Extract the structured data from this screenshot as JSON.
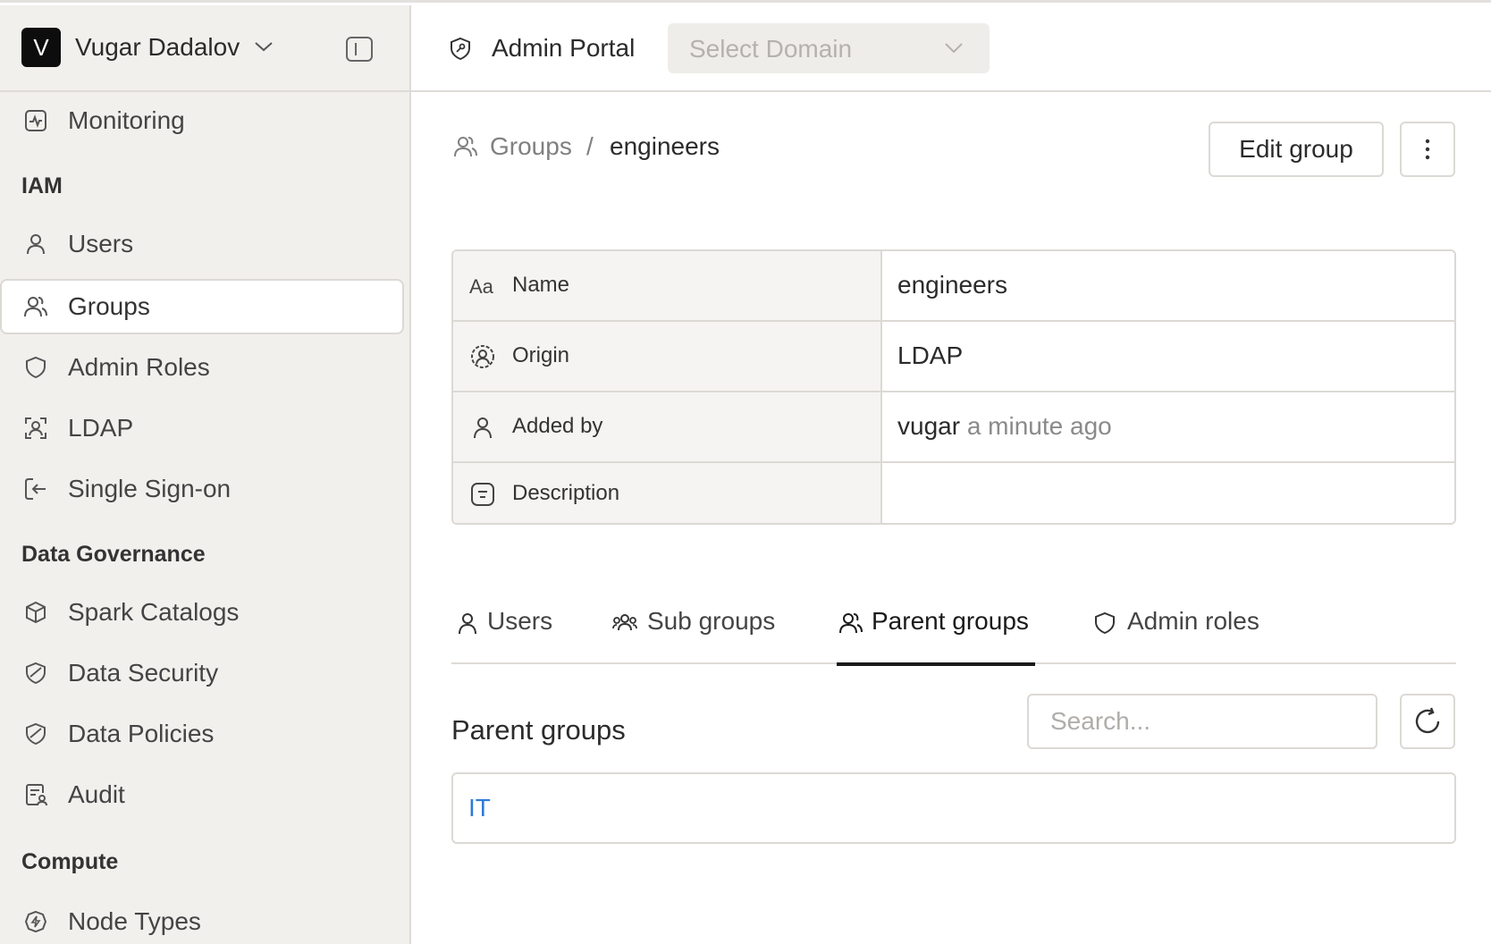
{
  "workspace": {
    "initial": "V",
    "name": "Vugar Dadalov"
  },
  "sidebar": {
    "top_items": [
      {
        "label": "Monitoring",
        "icon": "monitoring-icon"
      }
    ],
    "sections": [
      {
        "title": "IAM",
        "items": [
          {
            "label": "Users",
            "icon": "user-icon"
          },
          {
            "label": "Groups",
            "icon": "users-icon",
            "active": true
          },
          {
            "label": "Admin Roles",
            "icon": "shield-icon"
          },
          {
            "label": "LDAP",
            "icon": "ldap-icon"
          },
          {
            "label": "Single Sign-on",
            "icon": "sign-in-icon"
          }
        ]
      },
      {
        "title": "Data Governance",
        "items": [
          {
            "label": "Spark Catalogs",
            "icon": "cube-icon"
          },
          {
            "label": "Data Security",
            "icon": "shield-slash-icon"
          },
          {
            "label": "Data Policies",
            "icon": "shield-slash-icon"
          },
          {
            "label": "Audit",
            "icon": "audit-icon"
          }
        ]
      },
      {
        "title": "Compute",
        "items": [
          {
            "label": "Node Types",
            "icon": "chip-icon"
          }
        ]
      }
    ]
  },
  "topbar": {
    "title": "Admin Portal",
    "domain_placeholder": "Select Domain"
  },
  "breadcrumb": {
    "parent": "Groups",
    "separator": "/",
    "current": "engineers"
  },
  "actions": {
    "edit_label": "Edit group",
    "more_label": "⋮"
  },
  "properties": [
    {
      "key": "Name",
      "icon": "text-icon",
      "value": "engineers"
    },
    {
      "key": "Origin",
      "icon": "origin-icon",
      "value": "LDAP"
    },
    {
      "key": "Added by",
      "icon": "user-icon",
      "value": "vugar",
      "value_muted": "a minute ago"
    },
    {
      "key": "Description",
      "icon": "description-icon",
      "value": ""
    }
  ],
  "tabs": [
    {
      "label": "Users",
      "icon": "user-icon"
    },
    {
      "label": "Sub groups",
      "icon": "users-three-icon"
    },
    {
      "label": "Parent groups",
      "icon": "users-icon",
      "active": true
    },
    {
      "label": "Admin roles",
      "icon": "shield-icon"
    }
  ],
  "list": {
    "title": "Parent groups",
    "search_placeholder": "Search...",
    "items": [
      "IT"
    ]
  },
  "colors": {
    "sidebar_bg": "#f2f0ed",
    "link": "#2f7ad8",
    "active_tab": "#1a1a1a"
  }
}
